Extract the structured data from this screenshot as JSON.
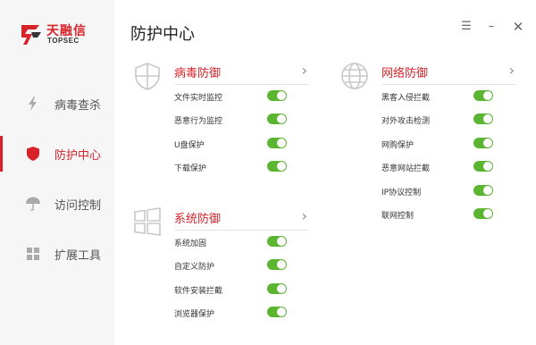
{
  "brand": {
    "cn": "天融信",
    "en": "TOPSEC"
  },
  "page_title": "防护中心",
  "colors": {
    "accent": "#d8232a",
    "toggle_on": "#5cb531"
  },
  "window_controls": [
    "menu-icon",
    "minimize-icon",
    "close-icon"
  ],
  "sidebar": {
    "items": [
      {
        "label": "病毒查杀",
        "icon": "lightning-icon"
      },
      {
        "label": "防护中心",
        "icon": "shield-icon",
        "active": true
      },
      {
        "label": "访问控制",
        "icon": "umbrella-icon"
      },
      {
        "label": "扩展工具",
        "icon": "grid-icon"
      }
    ]
  },
  "sections": {
    "virus": {
      "title": "病毒防御",
      "icon": "shield-outline-icon",
      "rows": [
        {
          "label": "文件实时监控",
          "on": true
        },
        {
          "label": "恶意行为监控",
          "on": true
        },
        {
          "label": "U盘保护",
          "on": true
        },
        {
          "label": "下载保护",
          "on": true
        }
      ]
    },
    "system": {
      "title": "系统防御",
      "icon": "windows-icon",
      "rows": [
        {
          "label": "系统加固",
          "on": true
        },
        {
          "label": "自定义防护",
          "on": true
        },
        {
          "label": "软件安装拦截",
          "on": true
        },
        {
          "label": "浏览器保护",
          "on": true
        }
      ]
    },
    "network": {
      "title": "网络防御",
      "icon": "globe-icon",
      "rows": [
        {
          "label": "黑客入侵拦截",
          "on": true
        },
        {
          "label": "对外攻击检测",
          "on": true
        },
        {
          "label": "网购保护",
          "on": true
        },
        {
          "label": "恶意网站拦截",
          "on": true
        },
        {
          "label": "IP协议控制",
          "on": true
        },
        {
          "label": "联网控制",
          "on": true
        }
      ]
    }
  }
}
